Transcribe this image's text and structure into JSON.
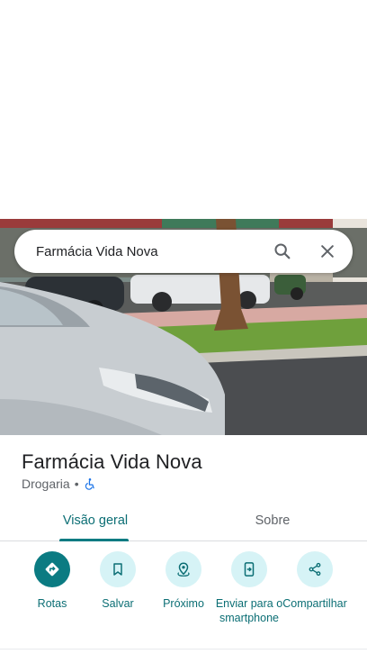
{
  "search": {
    "query": "Farmácia Vida Nova"
  },
  "photo": {
    "description_icon": "street-view-photo"
  },
  "place": {
    "name": "Farmácia Vida Nova",
    "category": "Drogaria",
    "separator": "•",
    "accessibility_icon": "wheelchair-icon"
  },
  "tabs": [
    {
      "label": "Visão geral",
      "active": true
    },
    {
      "label": "Sobre",
      "active": false
    }
  ],
  "actions": [
    {
      "label": "Rotas",
      "icon": "directions-icon"
    },
    {
      "label": "Salvar",
      "icon": "bookmark-icon"
    },
    {
      "label": "Próximo",
      "icon": "nearby-icon"
    },
    {
      "label": "Enviar para o smartphone",
      "icon": "send-to-phone-icon"
    },
    {
      "label": "Compartilhar",
      "icon": "share-icon"
    }
  ],
  "colors": {
    "accent": "#0b7b82",
    "accent_light": "#d6f3f6",
    "text_primary": "#202124",
    "text_secondary": "#5f6368"
  }
}
